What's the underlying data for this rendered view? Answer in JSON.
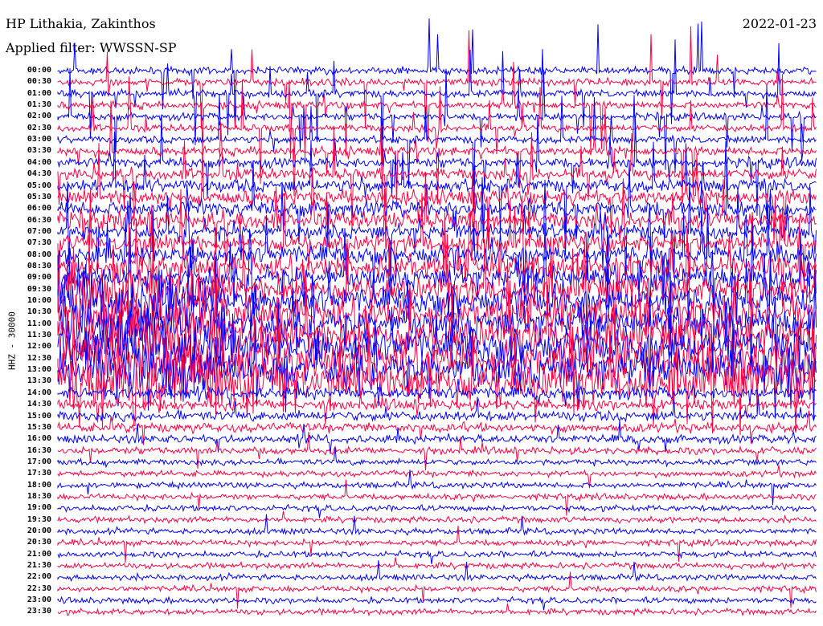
{
  "header": {
    "station": "HP Lithakia, Zakinthos",
    "filter": "Applied filter: WWSSN-SP",
    "date": "2022-01-23"
  },
  "chart_data": {
    "type": "line",
    "title": "HP Lithakia, Zakinthos",
    "ylabel": "HHZ - 30000",
    "xlabel": "",
    "colors": [
      "#0000ff",
      "#ff0040"
    ],
    "row_labels": [
      "00:00",
      "00:30",
      "01:00",
      "01:30",
      "02:00",
      "02:30",
      "03:00",
      "03:30",
      "04:00",
      "04:30",
      "05:00",
      "05:30",
      "06:00",
      "06:30",
      "07:00",
      "07:30",
      "08:00",
      "08:30",
      "09:00",
      "09:30",
      "10:00",
      "10:30",
      "11:00",
      "11:30",
      "12:00",
      "12:30",
      "13:00",
      "13:30",
      "14:00",
      "14:30",
      "15:00",
      "15:30",
      "16:00",
      "16:30",
      "17:00",
      "17:30",
      "18:00",
      "18:30",
      "19:00",
      "19:30",
      "20:00",
      "20:30",
      "21:00",
      "21:30",
      "22:00",
      "22:30",
      "23:00",
      "23:30"
    ]
  }
}
